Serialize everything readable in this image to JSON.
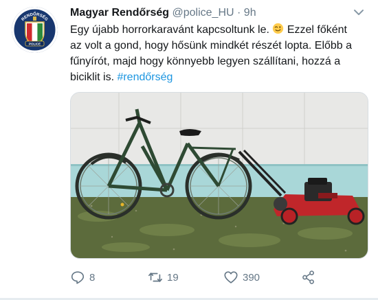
{
  "tweet": {
    "name": "Magyar Rendőrség",
    "handle": "@police_HU",
    "separator": "·",
    "time": "9h",
    "text_part1": "Egy újabb horrorkaravánt kapcsoltunk le.",
    "text_part2": " Ezzel főként az volt a gond, hogy hősünk mindkét részét lopta. Előbb a fűnyírót, majd hogy könnyebb legyen szállítani, hozzá a biciklit is. ",
    "hashtag": "#rendőrség",
    "avatar_text_top": "RENDŐRSÉG",
    "avatar_text_bottom": "POLICE"
  },
  "actions": {
    "reply_count": "8",
    "retweet_count": "19",
    "like_count": "390"
  },
  "icons": {
    "reply": "reply-icon",
    "retweet": "retweet-icon",
    "like": "heart-icon",
    "share": "share-icon",
    "more": "chevron-down-icon"
  },
  "colors": {
    "link": "#1b95e0",
    "muted": "#657786",
    "text": "#14171a",
    "mower_red": "#c0262a",
    "bike_green": "#2e4a33"
  }
}
